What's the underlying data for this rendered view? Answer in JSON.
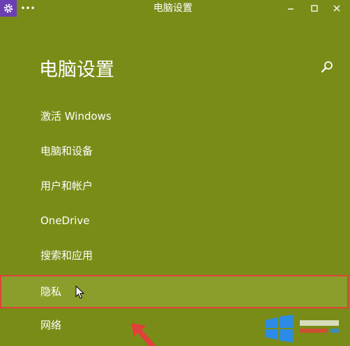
{
  "titlebar": {
    "title": "电脑设置",
    "system_menu_icon": "ellipsis-icon",
    "app_icon": "gear-icon",
    "minimize_icon": "minimize-icon",
    "maximize_icon": "maximize-icon",
    "close_icon": "close-icon"
  },
  "header": {
    "title": "电脑设置",
    "search_icon": "search-icon"
  },
  "nav": {
    "items": [
      {
        "label": "激活 Windows"
      },
      {
        "label": "电脑和设备"
      },
      {
        "label": "用户和帐户"
      },
      {
        "label": "OneDrive"
      },
      {
        "label": "搜索和应用"
      },
      {
        "label": "隐私",
        "selected": true
      },
      {
        "label": "网络"
      }
    ]
  },
  "colors": {
    "background": "#7a8c18",
    "selected_item": "#8b9e2c",
    "highlight_border": "#e0413a",
    "app_icon_bg": "#6a3fb4"
  }
}
